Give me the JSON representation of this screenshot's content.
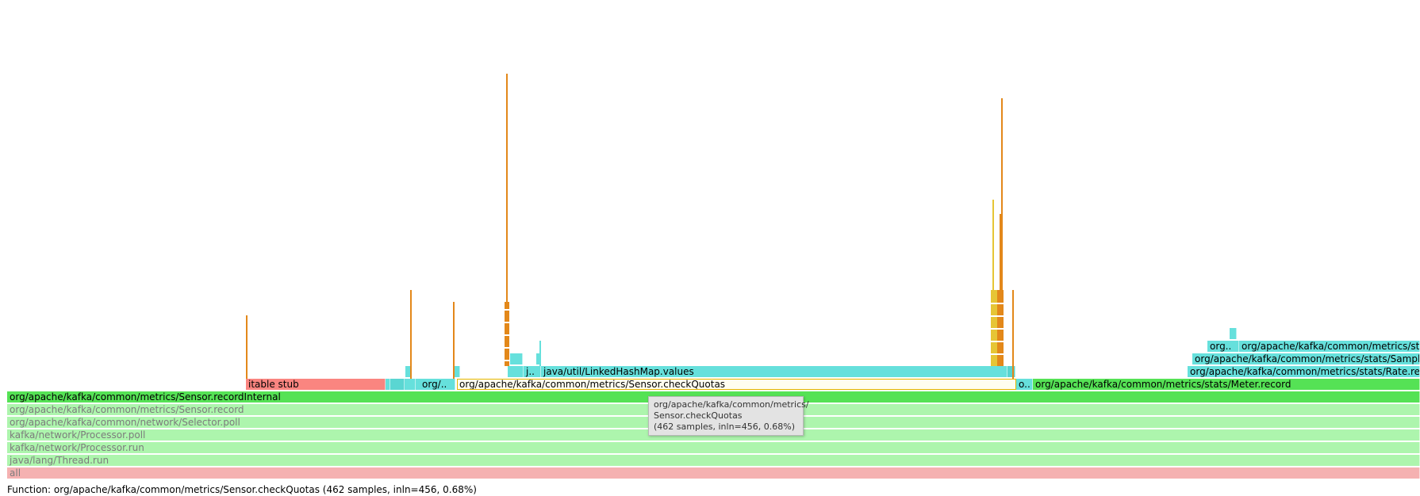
{
  "flamegraph": {
    "colors": {
      "green": "#55e255",
      "light_green": "#adf5ad",
      "teal": "#66e0dc",
      "salmon": "#fa8580",
      "pink": "#f5b1b1",
      "orange": "#e3881a",
      "yellow": "#e6c535",
      "highlight": "#fffef0"
    },
    "frames": {
      "all": "all",
      "thread_run": "java/lang/Thread.run",
      "processor_run": "kafka/network/Processor.run",
      "processor_poll": "kafka/network/Processor.poll",
      "selector_poll": "org/apache/kafka/common/network/Selector.poll",
      "sensor_record": "org/apache/kafka/common/metrics/Sensor.record",
      "sensor_record_internal": "org/apache/kafka/common/metrics/Sensor.recordInternal",
      "itable_stub": "itable stub",
      "org_trunc": "org/..",
      "check_quotas": "org/apache/kafka/common/metrics/Sensor.checkQuotas",
      "o_trunc": "o..",
      "meter_record": "org/apache/kafka/common/metrics/stats/Meter.record",
      "j_trunc": "j..",
      "linked_values": "java/util/LinkedHashMap.values",
      "rate_record": "org/apache/kafka/common/metrics/stats/Rate.record",
      "sampled_stat": "org/apache/kafka/common/metrics/stats/SampledStat.record",
      "org_trunc2": "org..",
      "stats_trunc": "org/apache/kafka/common/metrics/stats/SampledStat.update"
    }
  },
  "tooltip": {
    "line1": "org/apache/kafka/common/metrics/",
    "line2": "Sensor.checkQuotas",
    "line3": "(462 samples, inln=456, 0.68%)"
  },
  "status": {
    "function_text": "Function: org/apache/kafka/common/metrics/Sensor.checkQuotas (462 samples, inln=456, 0.68%)"
  }
}
